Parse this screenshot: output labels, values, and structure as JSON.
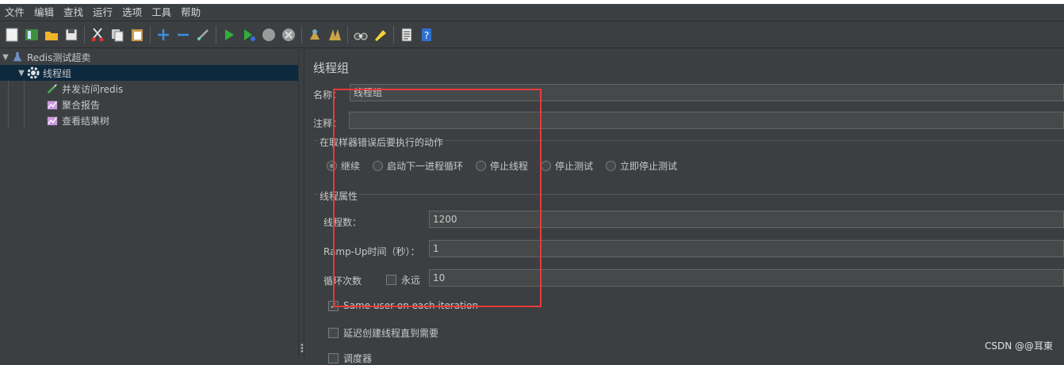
{
  "menubar": [
    "文件",
    "编辑",
    "查找",
    "运行",
    "选项",
    "工具",
    "帮助"
  ],
  "toolbar": {
    "buttons": [
      "new-icon",
      "templates-icon",
      "open-icon",
      "save-icon",
      "cut-icon",
      "copy-icon",
      "paste-icon",
      "expand-icon",
      "collapse-icon",
      "toggle-icon",
      "start-icon",
      "start-no-pause-icon",
      "stop-icon",
      "shutdown-icon",
      "clear-icon",
      "clear-all-icon",
      "search-icon",
      "reset-search-icon",
      "function-helper-icon",
      "help-icon"
    ]
  },
  "tree": {
    "items": [
      {
        "label": "Redis测试超卖"
      },
      {
        "label": "线程组"
      },
      {
        "label": "并发访问redis"
      },
      {
        "label": "聚合报告"
      },
      {
        "label": "查看结果树"
      }
    ]
  },
  "panel": {
    "title": "线程组",
    "name_label": "名称：",
    "name_value": "线程组",
    "comment_label": "注释：",
    "comment_value": "",
    "error_action": {
      "title": "在取样器错误后要执行的动作",
      "options": [
        "继续",
        "启动下一进程循环",
        "停止线程",
        "停止测试",
        "立即停止测试"
      ],
      "selected": "继续"
    },
    "thread_props": {
      "title": "线程属性",
      "threads_label": "线程数：",
      "threads_value": "1200",
      "rampup_label": "Ramp-Up时间（秒）：",
      "rampup_value": "1",
      "loop_label": "循环次数",
      "forever_label": "永远",
      "loop_value": "10",
      "same_user_label": "Same user on each iteration",
      "delay_label": "延迟创建线程直到需要",
      "scheduler_label": "调度器"
    }
  },
  "watermark": "CSDN @@耳東",
  "colors": {
    "highlight": "#e8393a",
    "selection": "#0d293e"
  }
}
